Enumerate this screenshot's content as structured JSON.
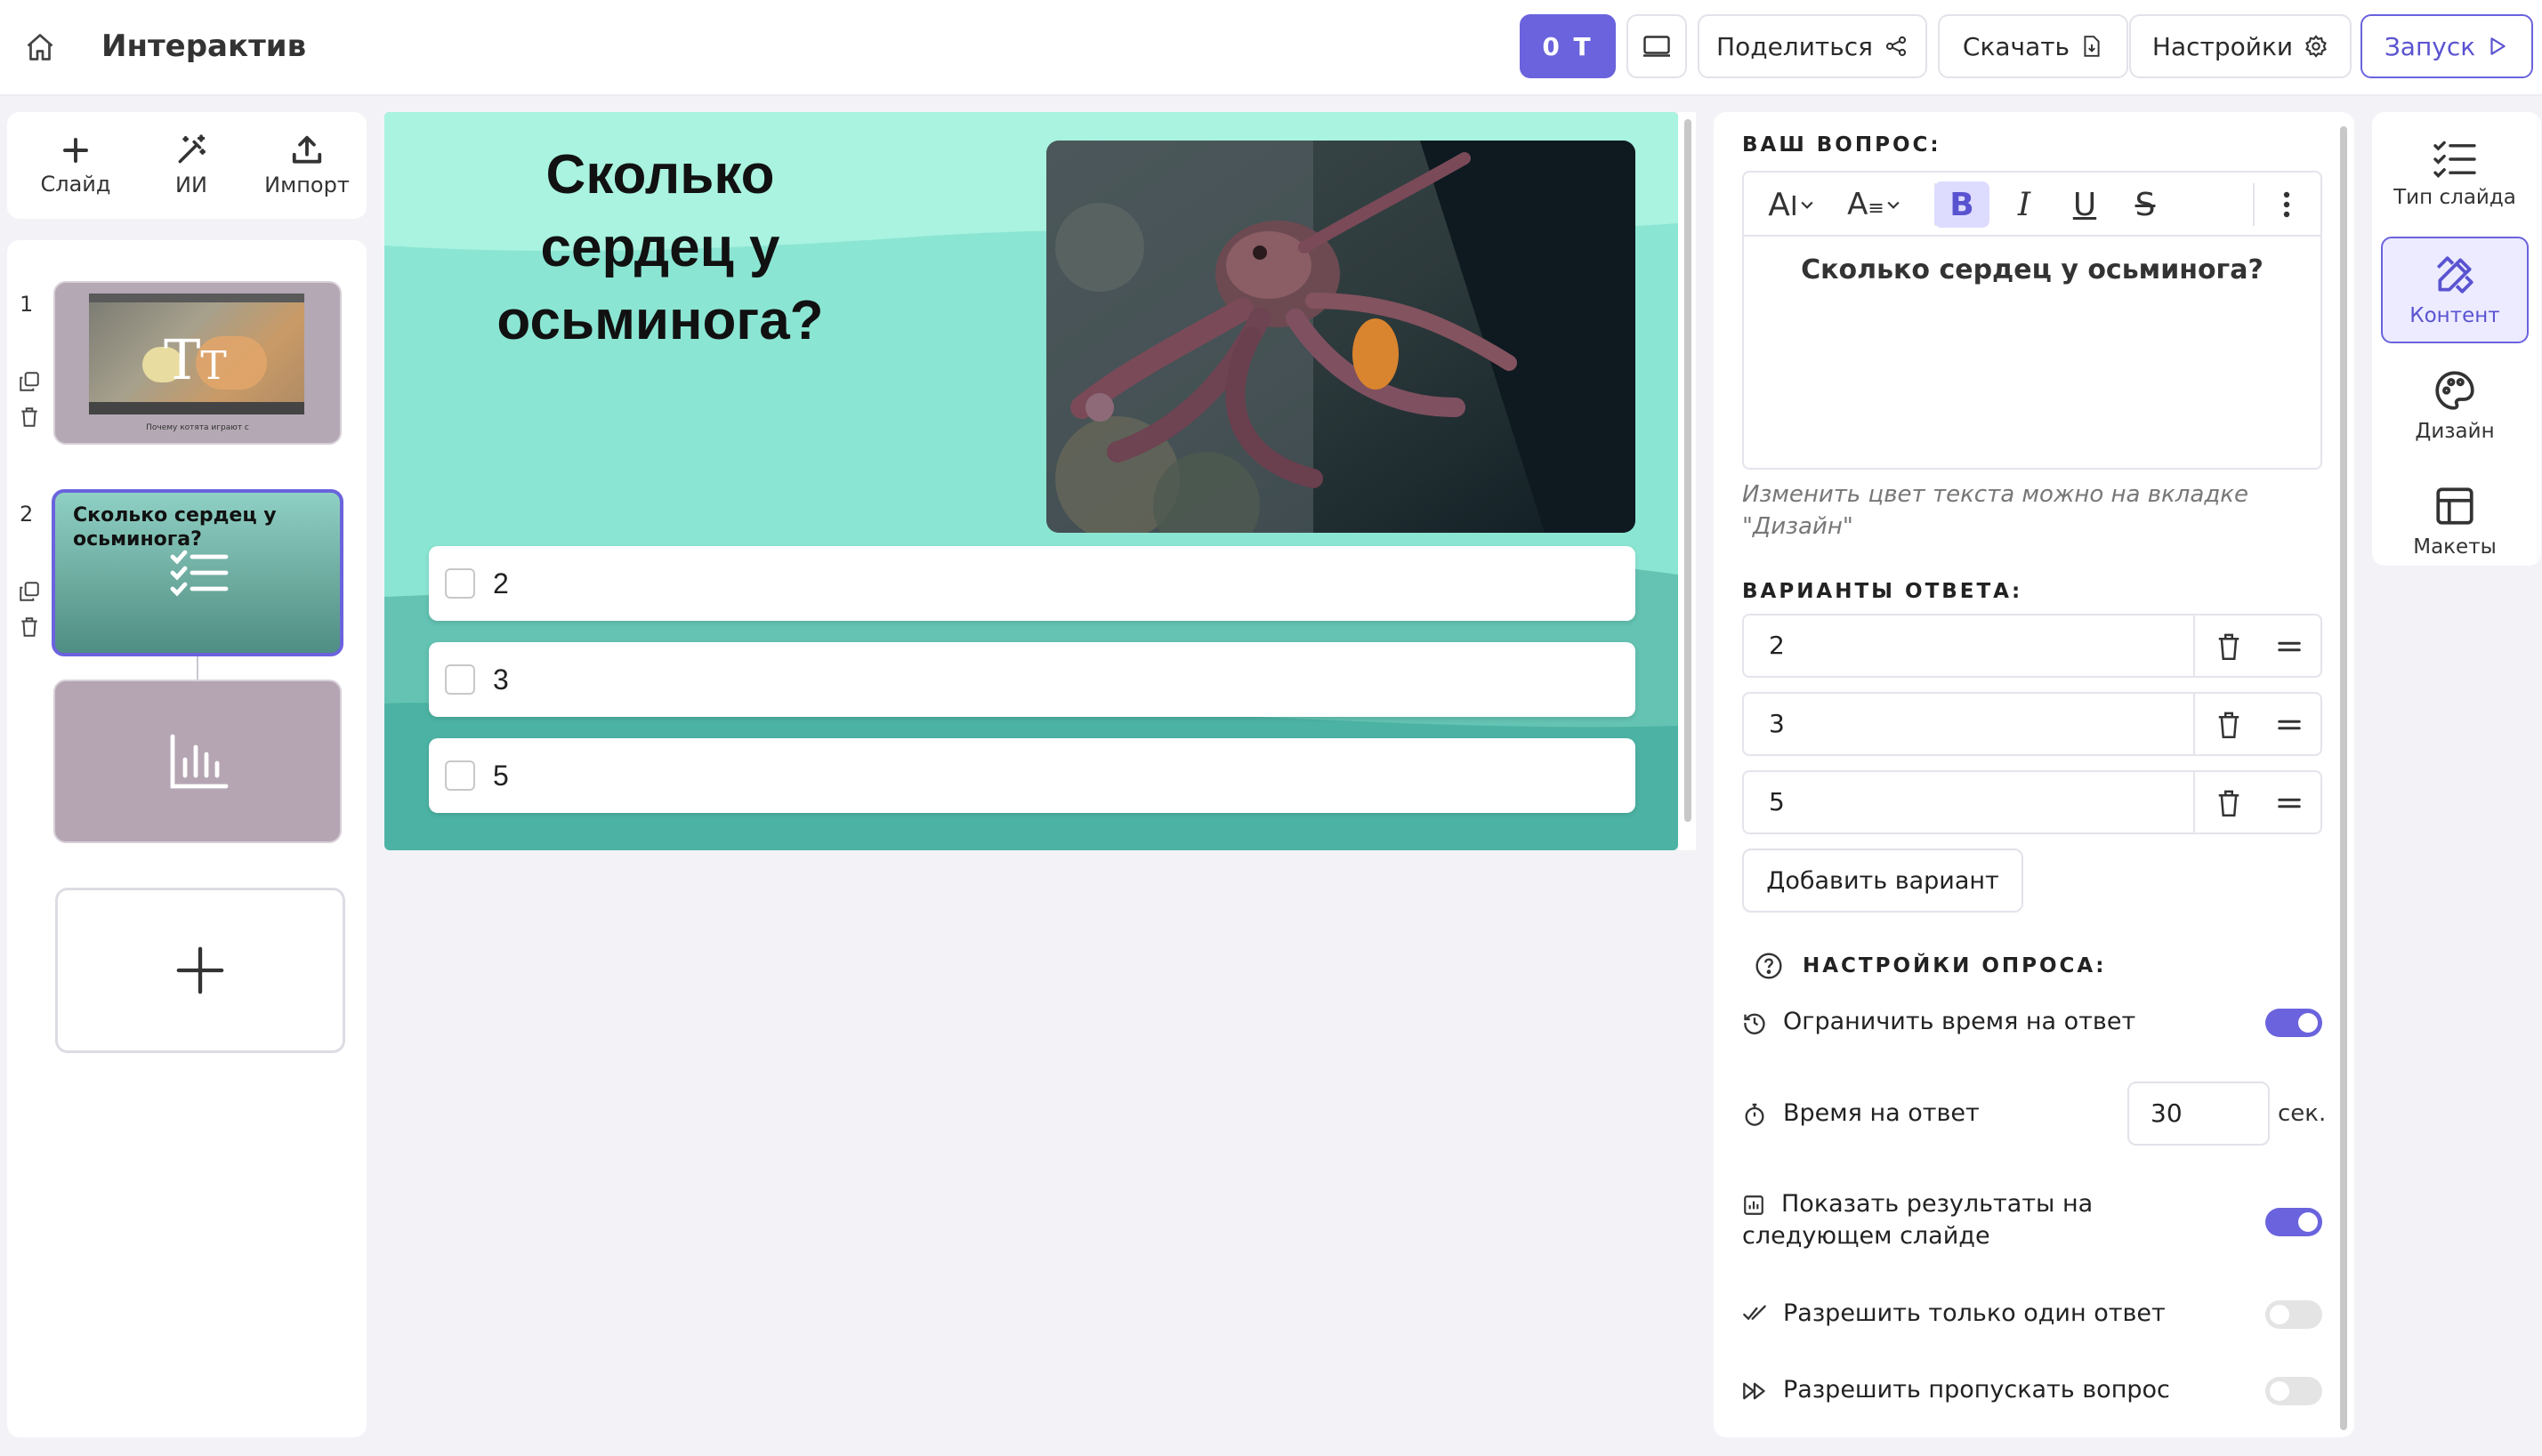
{
  "header": {
    "title": "Интерактив",
    "participants_label": "0 T",
    "share_label": "Поделиться",
    "download_label": "Скачать",
    "settings_label": "Настройки",
    "launch_label": "Запуск"
  },
  "tools": {
    "slide_label": "Слайд",
    "ai_label": "ИИ",
    "import_label": "Импорт"
  },
  "slides_list": [
    {
      "number": "1",
      "caption": "Почему котята играют с"
    },
    {
      "number": "2",
      "title": "Сколько сердец у осьминога?"
    }
  ],
  "slide": {
    "question": "Сколько сердец у осьминога?",
    "answers": [
      "2",
      "3",
      "5"
    ],
    "bg_top": "#a8f0dc",
    "bg_bottom": "#4cb3a4"
  },
  "content_panel": {
    "question_label": "ВАШ ВОПРОС:",
    "question_text": "Сколько сердец у осьминога?",
    "hint": "Изменить цвет текста можно на вкладке \"Дизайн\"",
    "answers_label": "ВАРИАНТЫ ОТВЕТА:",
    "options": [
      "2",
      "3",
      "5"
    ],
    "add_option_label": "Добавить вариант",
    "poll_settings_label": "НАСТРОЙКИ ОПРОСА:",
    "settings": {
      "limit_time": {
        "label": "Ограничить время на ответ",
        "enabled": true
      },
      "answer_time": {
        "label": "Время на ответ",
        "value": "30",
        "unit": "сек."
      },
      "show_results": {
        "label": "Показать результаты на следующем слайде",
        "enabled": true
      },
      "single_answer": {
        "label": "Разрешить только один ответ",
        "enabled": false
      },
      "allow_skip": {
        "label": "Разрешить пропускать вопрос",
        "enabled": false
      }
    }
  },
  "right_nav": {
    "slide_type": "Тип слайда",
    "content": "Контент",
    "design": "Дизайн",
    "layouts": "Макеты"
  },
  "colors": {
    "accent": "#6a63dd",
    "app_bg": "#f3f3f7"
  }
}
